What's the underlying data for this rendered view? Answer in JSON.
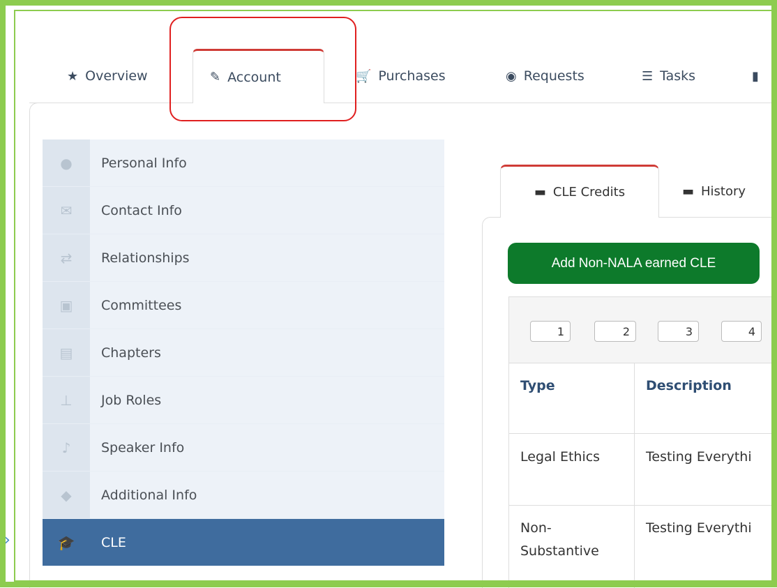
{
  "top_tabs": [
    {
      "label": "Overview",
      "icon": "star-icon"
    },
    {
      "label": "Account",
      "icon": "edit-icon"
    },
    {
      "label": "Purchases",
      "icon": "cart-icon"
    },
    {
      "label": "Requests",
      "icon": "lifering-icon"
    },
    {
      "label": "Tasks",
      "icon": "tasks-icon"
    }
  ],
  "sidebar": {
    "items": [
      {
        "label": "Personal Info",
        "icon": "user-icon"
      },
      {
        "label": "Contact Info",
        "icon": "envelope-icon"
      },
      {
        "label": "Relationships",
        "icon": "retweet-icon"
      },
      {
        "label": "Committees",
        "icon": "briefcase-icon"
      },
      {
        "label": "Chapters",
        "icon": "archive-icon"
      },
      {
        "label": "Job Roles",
        "icon": "sitemap-icon"
      },
      {
        "label": "Speaker Info",
        "icon": "microphone-icon"
      },
      {
        "label": "Additional Info",
        "icon": "tags-icon"
      },
      {
        "label": "CLE",
        "icon": "graduation-cap-icon"
      }
    ],
    "active": "CLE"
  },
  "inner_tabs": [
    {
      "label": "CLE Credits",
      "icon": "ticket-icon"
    },
    {
      "label": "History",
      "icon": "ticket-icon"
    }
  ],
  "add_button": {
    "label": "Add Non-NALA earned CLE"
  },
  "pager": [
    "1",
    "2",
    "3",
    "4"
  ],
  "table": {
    "headers": [
      "Type",
      "Description"
    ],
    "rows": [
      {
        "type": "Legal Ethics",
        "description": "Testing Everythi"
      },
      {
        "type_line1": "Non-",
        "type_line2": "Substantive",
        "description": "Testing Everythi"
      }
    ]
  },
  "colors": {
    "frame": "#8dcc4f",
    "active_tab_border": "#cf3b36",
    "highlight": "#e01f1f",
    "sidebar_active": "#3f6c9e",
    "button": "#0d7a2b"
  }
}
